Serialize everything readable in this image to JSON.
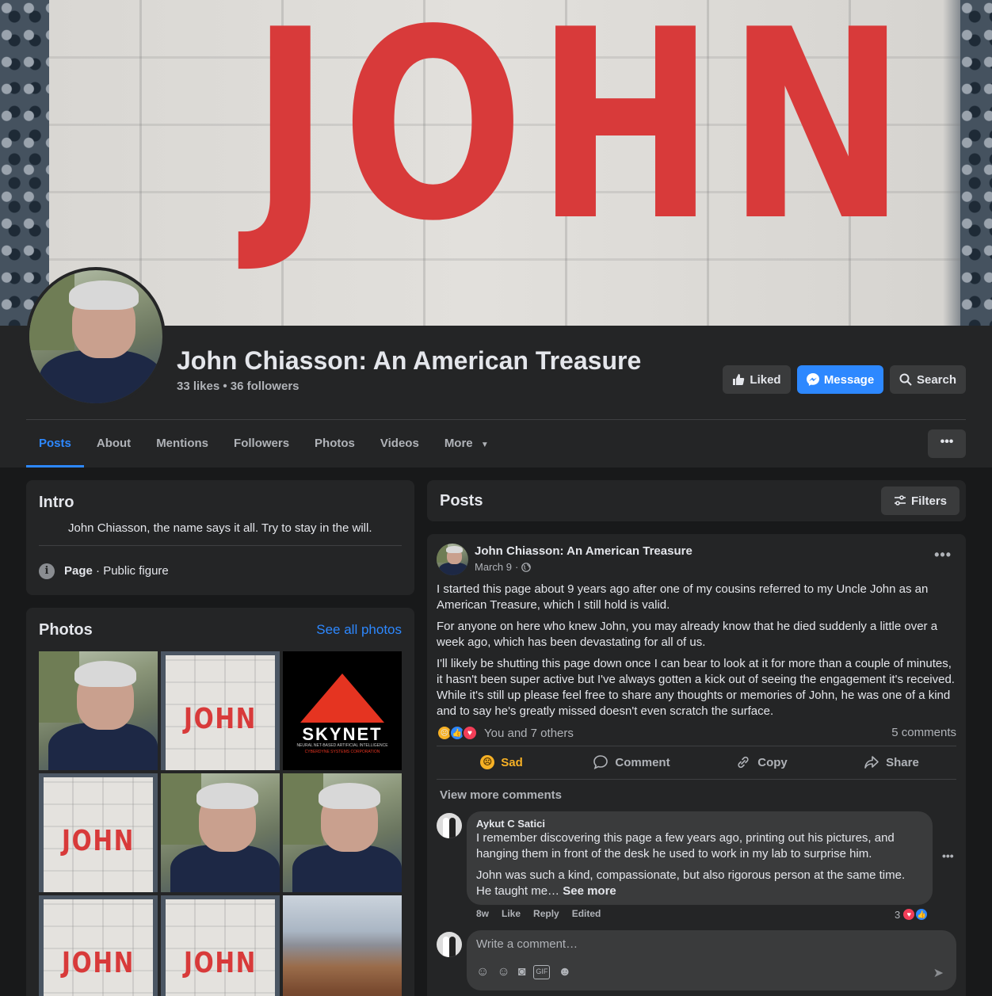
{
  "cover": {
    "text": "JOHN"
  },
  "page": {
    "title": "John Chiasson: An American Treasure",
    "stats": "33 likes • 36 followers"
  },
  "actions": {
    "liked": "Liked",
    "message": "Message",
    "search": "Search"
  },
  "tabs": [
    {
      "label": "Posts",
      "active": true
    },
    {
      "label": "About"
    },
    {
      "label": "Mentions"
    },
    {
      "label": "Followers"
    },
    {
      "label": "Photos"
    },
    {
      "label": "Videos"
    },
    {
      "label": "More"
    }
  ],
  "more_menu": "•••",
  "intro": {
    "title": "Intro",
    "bio": "John Chiasson, the name says it all. Try to stay in the will.",
    "page_label": "Page",
    "category": "Public figure"
  },
  "photos": {
    "title": "Photos",
    "see_all": "See all photos",
    "tile_text": "JOHN",
    "skynet": {
      "word": "SKYNET",
      "tagline": "NEURAL NET-BASED ARTIFICIAL INTELLIGENCE",
      "sub": "CYBERDYNE SYSTEMS CORPORATION"
    }
  },
  "posts": {
    "title": "Posts",
    "filters": "Filters"
  },
  "post": {
    "author": "John Chiasson: An American Treasure",
    "date": "March 9",
    "paragraphs": [
      "I started this page about 9 years ago after one of my cousins referred to my Uncle John as an American Treasure, which I still hold is valid.",
      "For anyone on here who knew John, you may already know that he died suddenly a little over a week ago, which has been devastating for all of us.",
      "I'll likely be shutting this page down once I can bear to look at it for more than a couple of minutes, it hasn't been super active but I've always gotten a kick out of seeing the engagement it's received. While it's still up please feel free to share any thoughts or memories of John, he was one of a kind and to say he's greatly missed doesn't even scratch the surface."
    ],
    "reactions_text": "You and 7 others",
    "comments_count": "5 comments",
    "action_sad": "Sad",
    "action_comment": "Comment",
    "action_copy": "Copy",
    "action_share": "Share",
    "view_more": "View more comments"
  },
  "comment": {
    "name": "Aykut C Satici",
    "p1": "I remember discovering this page a few years ago, printing out his pictures, and hanging them in front of the desk he used to work in my lab to surprise him.",
    "p2": "John was such a kind, compassionate, but also rigorous person at the same time. He taught me…",
    "see_more": "See more",
    "time": "8w",
    "like": "Like",
    "reply": "Reply",
    "edited": "Edited",
    "reaction_count": "3"
  },
  "composer": {
    "placeholder": "Write a comment…"
  },
  "colors": {
    "accent": "#2d88ff",
    "background": "#18191a",
    "card": "#242526",
    "sad": "#f7b125",
    "love": "#f33e58"
  }
}
